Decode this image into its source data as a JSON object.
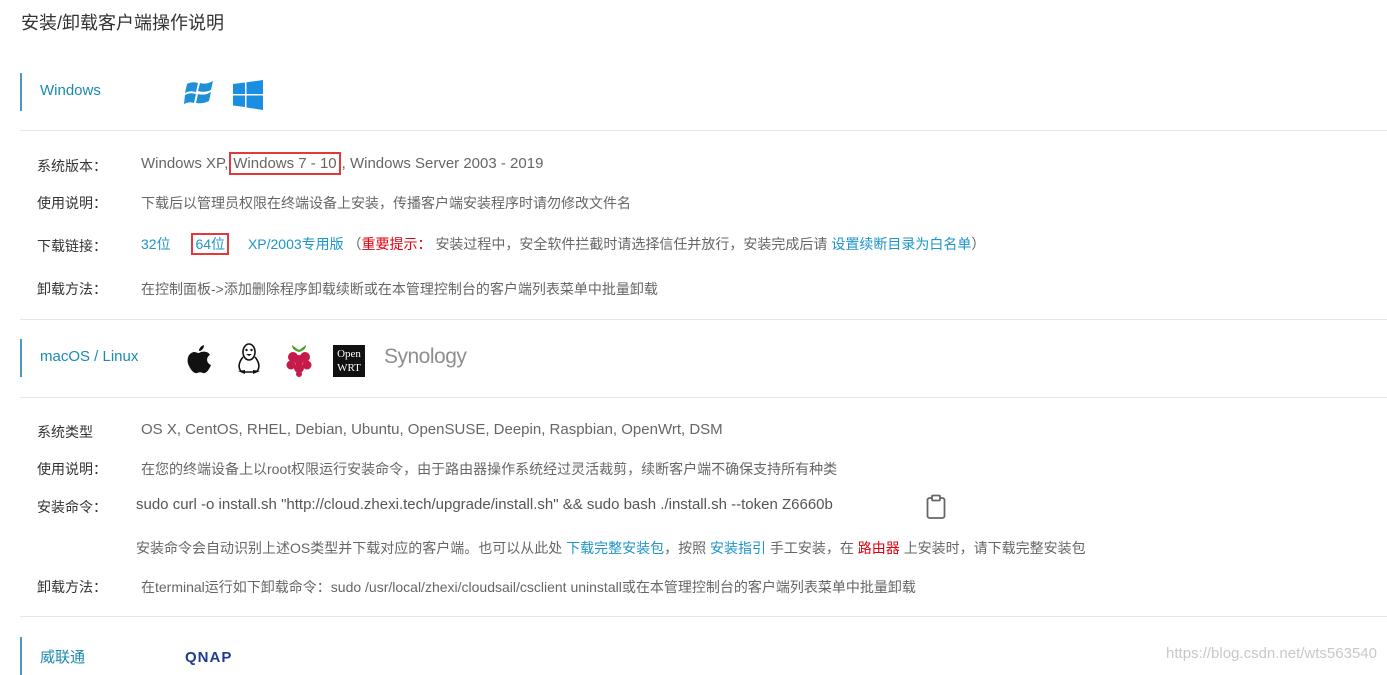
{
  "page": {
    "title": "安装/卸载客户端操作说明"
  },
  "windows": {
    "name": "Windows",
    "rows": {
      "version_label": "系统版本：",
      "version_xp": "Windows XP,",
      "version_7_10": "Windows 7 - 10",
      "version_server": ", Windows Server 2003 - 2019",
      "usage_label": "使用说明：",
      "usage_text": "下载后以管理员权限在终端设备上安装，传播客户端安装程序时请勿修改文件名",
      "download_label": "下载链接：",
      "link_32": "32位",
      "link_64": "64位",
      "link_xp": "XP/2003专用版",
      "paren_open": "（",
      "important": "重要提示：",
      "important_text": "安装过程中，安全软件拦截时请选择信任并放行，安装完成后请",
      "whitelist_link": "设置续断目录为白名单",
      "paren_close": "）",
      "uninstall_label": "卸载方法：",
      "uninstall_text": "在控制面板->添加删除程序卸载续断或在本管理控制台的客户端列表菜单中批量卸载"
    }
  },
  "mac_linux": {
    "name": "macOS / Linux",
    "icons": [
      "apple-icon",
      "linux-tux-icon",
      "raspberry-pi-icon",
      "openwrt-icon",
      "synology-logo"
    ],
    "openwrt_line1": "Open",
    "openwrt_line2": "WRT",
    "synology": "Synology",
    "rows": {
      "systems_label": "系统类型",
      "systems_text": "OS X, CentOS, RHEL, Debian, Ubuntu, OpenSUSE, Deepin, Raspbian, OpenWrt, DSM",
      "usage_label": "使用说明：",
      "usage_text": "在您的终端设备上以root权限运行安装命令，由于路由器操作系统经过灵活裁剪，续断客户端不确保支持所有种类",
      "cmd_label": "安装命令：",
      "cmd_text": "sudo curl -o install.sh \"http://cloud.zhexi.tech/upgrade/install.sh\" && sudo bash ./install.sh --token Z6660b",
      "note_a": "安装命令会自动识别上述OS类型并下载对应的客户端。也可以从此处",
      "note_link_pkg": "下载完整安装包",
      "note_b": "，按照",
      "note_link_guide": "安装指引",
      "note_c": "手工安装，在",
      "note_router": "路由器",
      "note_d": "上安装时，请下载完整安装包",
      "uninstall_label": "卸载方法：",
      "uninstall_text": "在terminal运行如下卸载命令：sudo /usr/local/zhexi/cloudsail/csclient uninstall或在本管理控制台的客户端列表菜单中批量卸载"
    }
  },
  "qnap": {
    "name": "威联通",
    "logo": "QNAP"
  },
  "watermark": "https://blog.csdn.net/wts563540",
  "colors": {
    "accent": "#1c95c8",
    "warning": "#e0000f",
    "highlight_box": "#e23a3a"
  }
}
